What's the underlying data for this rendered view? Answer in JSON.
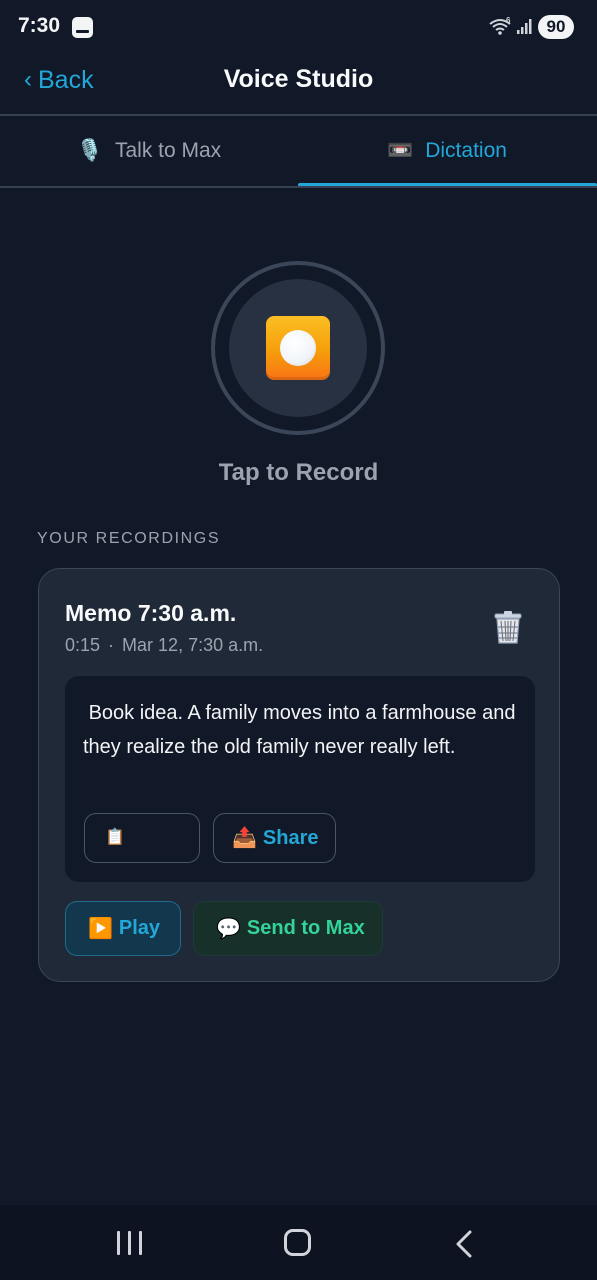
{
  "status_bar": {
    "time": "7:30",
    "battery_level": "90",
    "icons": [
      "app-notification-icon",
      "wifi-icon",
      "signal-icon",
      "battery-icon"
    ]
  },
  "header": {
    "back_label": "Back",
    "title": "Voice Studio"
  },
  "tabs": [
    {
      "label": "Talk to Max",
      "icon": "microphone-icon",
      "glyph": "🎙️",
      "active": false
    },
    {
      "label": "Dictation",
      "icon": "videocassette-icon",
      "glyph": "📼",
      "active": true
    }
  ],
  "record": {
    "label": "Tap to Record",
    "icon": "record-button-icon"
  },
  "recordings_section": {
    "label": "YOUR RECORDINGS"
  },
  "recordings": [
    {
      "title": "Memo 7:30 a.m.",
      "duration": "0:15",
      "separator": "·",
      "date": "Mar 12, 7:30 a.m.",
      "transcript": " Book idea. A family moves into a farmhouse and they realize the old family never really left.",
      "copy_glyph": "📋",
      "share_glyph": "📤",
      "share_label": "Share",
      "play_glyph": "▶️",
      "play_label": "Play",
      "send_glyph": "💬",
      "send_label": "Send to Max"
    }
  ],
  "colors": {
    "background": "#111827",
    "card": "#1f2937",
    "accent": "#22a7d8",
    "send_green": "#34d399",
    "muted_text": "#9ca3af"
  }
}
